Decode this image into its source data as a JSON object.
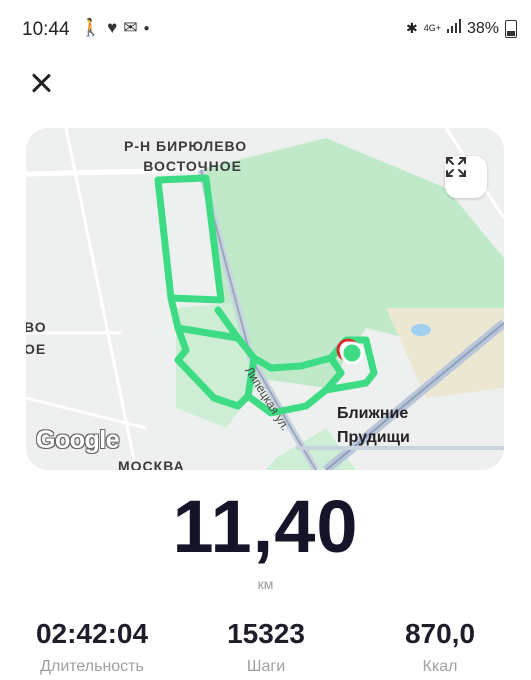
{
  "status": {
    "time": "10:44",
    "network": "4G+",
    "battery": "38%"
  },
  "map": {
    "district_label": "Р-Н БИРЮЛЕВО ВОСТОЧНОЕ",
    "district_line1": "Р-Н БИРЮЛЕВО",
    "district_line2": "ВОСТОЧНОЕ",
    "west_label_line1": "ВО",
    "west_label_line2": "ОЕ",
    "street_label": "Липецкая ул.",
    "village_line1": "Ближние",
    "village_line2": "Прудищи",
    "moscow_label": "МОСКВА",
    "attribution": "Google",
    "route_color": "#3ddc84"
  },
  "workout": {
    "distance": "11,40",
    "distance_unit": "км",
    "stats": [
      {
        "value": "02:42:04",
        "label": "Длительность"
      },
      {
        "value": "15323",
        "label": "Шаги"
      },
      {
        "value": "870,0",
        "label": "Ккал"
      }
    ]
  }
}
